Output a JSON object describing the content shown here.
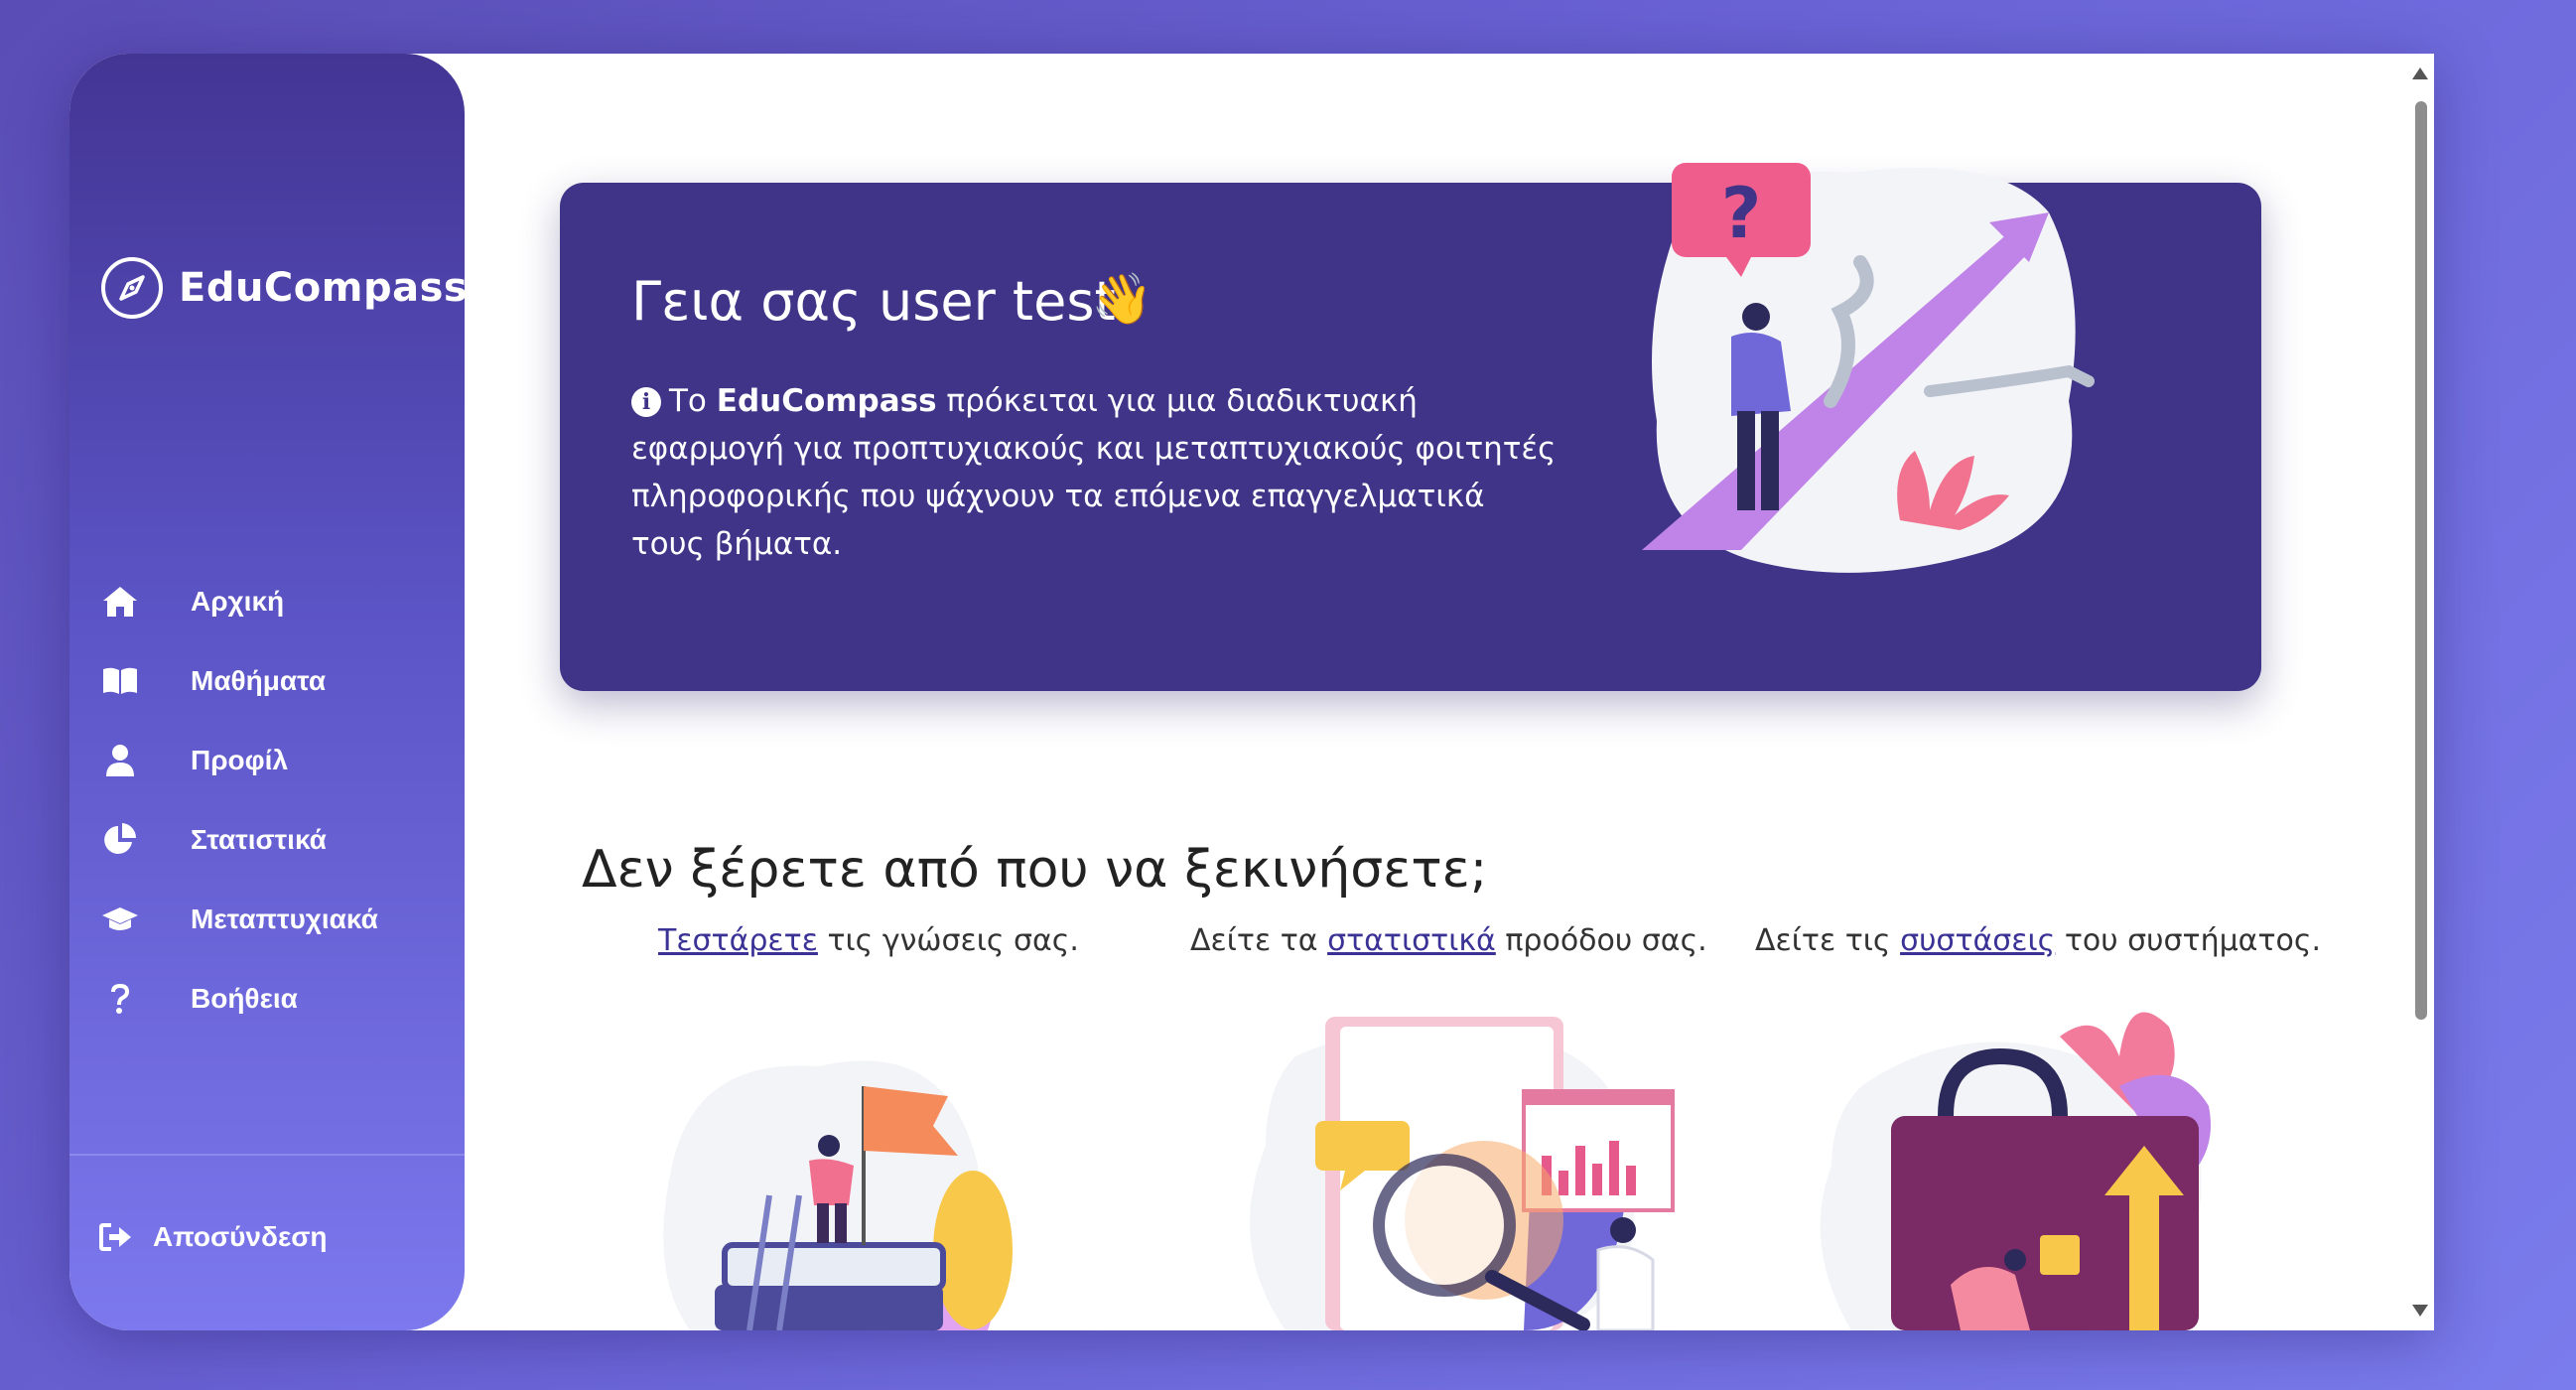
{
  "app": {
    "brand": "EduCompass",
    "colors": {
      "accent": "#3f3488",
      "sidebar_top": "#433594",
      "sidebar_bottom": "#7c78ed",
      "link": "#3b3296"
    }
  },
  "sidebar": {
    "items": [
      {
        "label": "Αρχική",
        "icon": "home-icon"
      },
      {
        "label": "Μαθήματα",
        "icon": "book-icon"
      },
      {
        "label": "Προφίλ",
        "icon": "user-icon"
      },
      {
        "label": "Στατιστικά",
        "icon": "pie-chart-icon"
      },
      {
        "label": "Μεταπτυχιακά",
        "icon": "graduation-cap-icon"
      },
      {
        "label": "Βοήθεια",
        "icon": "question-icon"
      }
    ],
    "logout": {
      "label": "Αποσύνδεση",
      "icon": "logout-icon"
    }
  },
  "hero": {
    "greeting": "Γεια σας user test",
    "wave": "👋",
    "intro_prefix": "Το ",
    "intro_brand": "EduCompass",
    "intro_rest": " πρόκειται για μια διαδικτυακή εφαρμογή για προπτυχιακούς και μεταπτυχιακούς φοιτητές πληροφορικής που ψάχνουν τα επόμενα επαγγελματικά τους βήματα."
  },
  "start": {
    "title": "Δεν ξέρετε από που να ξεκινήσετε;",
    "cards": [
      {
        "pre": "",
        "link": "Τεστάρετε",
        "post": " τις γνώσεις σας."
      },
      {
        "pre": "Δείτε τα ",
        "link": "στατιστικά",
        "post": " προόδου σας."
      },
      {
        "pre": "Δείτε τις ",
        "link": "συστάσεις",
        "post": " του συστήματος."
      }
    ]
  }
}
